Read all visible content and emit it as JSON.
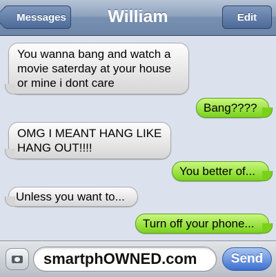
{
  "nav": {
    "back_label": "Messages",
    "title": "William",
    "edit_label": "Edit"
  },
  "messages": [
    {
      "direction": "incoming",
      "text": "You wanna bang and watch a movie saterday at your house or mine i dont care"
    },
    {
      "direction": "outgoing",
      "text": "Bang????"
    },
    {
      "direction": "incoming",
      "text": "OMG I MEANT HANG LIKE HANG OUT!!!!"
    },
    {
      "direction": "outgoing",
      "text": "You better of..."
    },
    {
      "direction": "incoming",
      "text": "Unless you want to..."
    },
    {
      "direction": "outgoing",
      "text": "Turn off your phone..."
    }
  ],
  "compose": {
    "input_value": "smartphOWNED.com",
    "send_label": "Send",
    "camera_icon": "camera-icon"
  },
  "colors": {
    "incoming_bubble": "#e6e6e6",
    "outgoing_bubble": "#8fe03a",
    "nav_bar": "#7890b1",
    "send_button": "#3b6fd0"
  }
}
